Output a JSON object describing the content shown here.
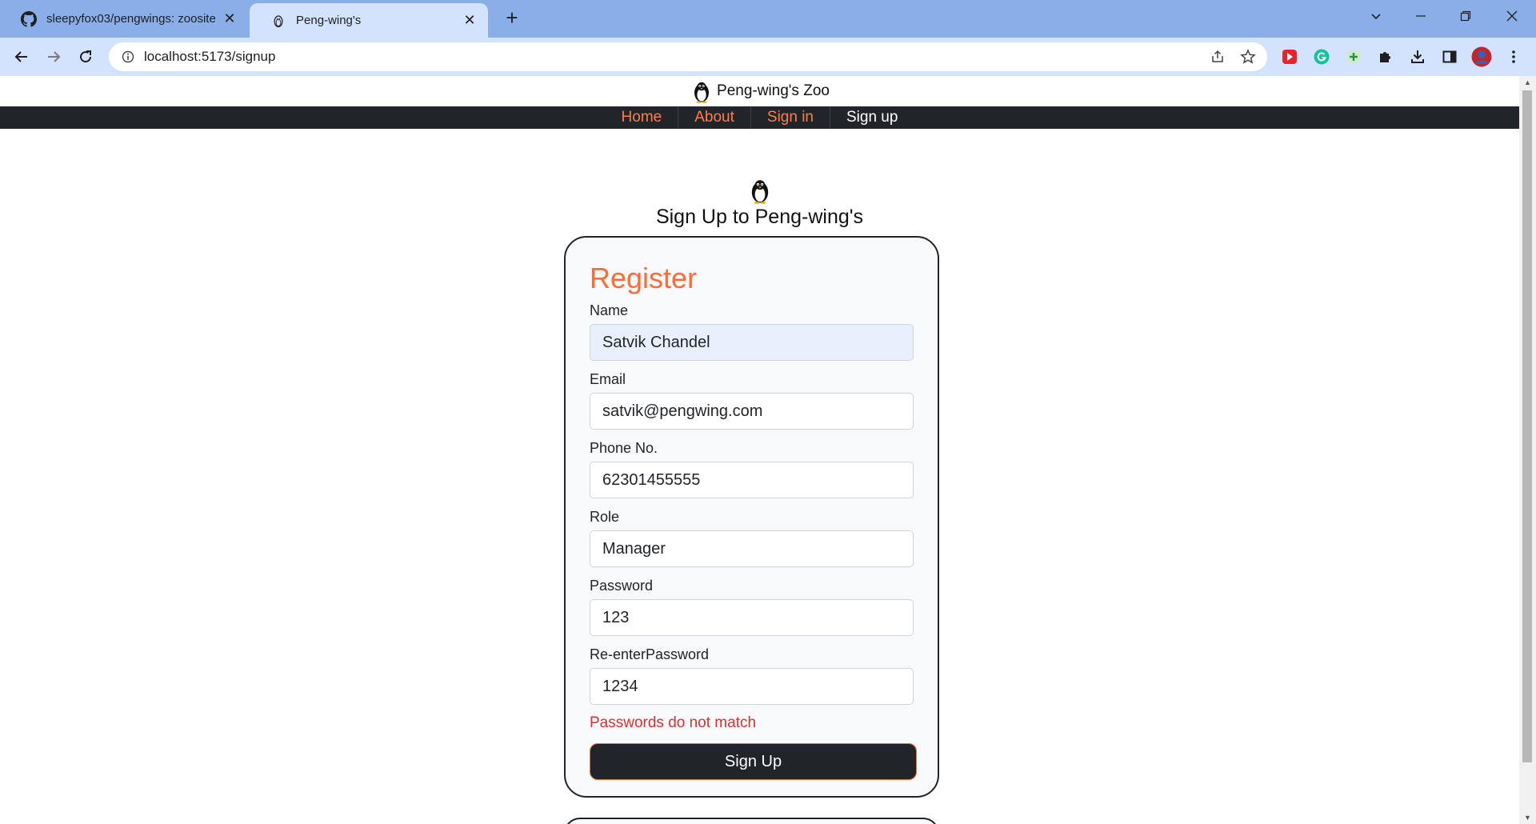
{
  "browser": {
    "tabs": [
      {
        "title": "sleepyfox03/pengwings: zoosite",
        "active": false
      },
      {
        "title": "Peng-wing's",
        "active": true
      }
    ],
    "url": "localhost:5173/signup"
  },
  "site": {
    "brand": "Peng-wing's Zoo",
    "nav": [
      "Home",
      "About",
      "Sign in",
      "Sign up"
    ]
  },
  "page": {
    "heading": "Sign Up to Peng-wing's"
  },
  "form": {
    "title": "Register",
    "fields": {
      "name": {
        "label": "Name",
        "value": "Satvik Chandel"
      },
      "email": {
        "label": "Email",
        "value": "satvik@pengwing.com"
      },
      "phone": {
        "label": "Phone No.",
        "value": "62301455555"
      },
      "role": {
        "label": "Role",
        "value": "Manager"
      },
      "password": {
        "label": "Password",
        "value": "123"
      },
      "repassword": {
        "label": "Re-enterPassword",
        "value": "1234"
      }
    },
    "error": "Passwords do not match",
    "submit_label": "Sign Up"
  },
  "colors": {
    "accent": "#fd6a36",
    "navbar": "#212529",
    "error": "#dc2f2f"
  }
}
